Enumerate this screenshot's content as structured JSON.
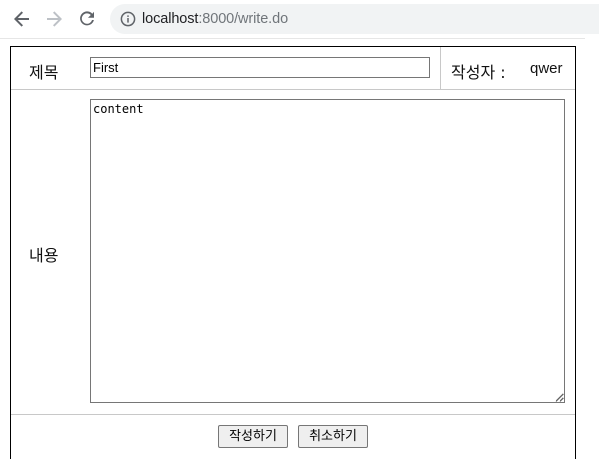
{
  "browser": {
    "url_host": "localhost",
    "url_path": ":8000/write.do",
    "icons": {
      "back": "arrow-left-icon",
      "forward": "arrow-right-icon",
      "reload": "reload-icon",
      "info": "info-icon"
    }
  },
  "form": {
    "title_label": "제목",
    "title_value": "First",
    "author_label": "작성자 :",
    "author_value": "qwer",
    "content_label": "내용",
    "content_value": "content",
    "submit_label": "작성하기",
    "cancel_label": "취소하기"
  },
  "colors": {
    "table_border": "#000000",
    "row_divider": "#c8c8c8",
    "button_bg": "#efefef",
    "omnibox_bg": "#f1f3f4"
  }
}
